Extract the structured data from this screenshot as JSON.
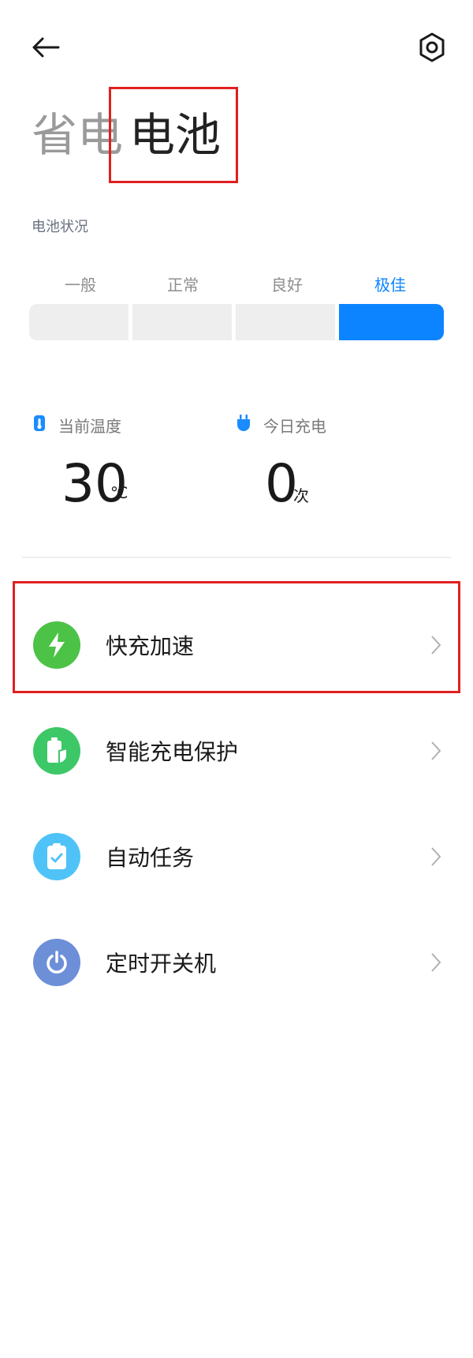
{
  "header": {
    "back_icon": "arrow-left-icon",
    "settings_icon": "hexagon-settings-icon"
  },
  "tabs": [
    {
      "label": "省电",
      "active": false
    },
    {
      "label": "电池",
      "active": true
    }
  ],
  "battery_status": {
    "title": "电池状况",
    "levels": [
      "一般",
      "正常",
      "良好",
      "极佳"
    ],
    "current_index": 3,
    "accent": "#0d84ff"
  },
  "stats": {
    "temperature": {
      "title": "当前温度",
      "value": "30",
      "unit": "℃",
      "icon": "thermometer-icon",
      "icon_color": "#1a8cff"
    },
    "charges_today": {
      "title": "今日充电",
      "value": "0",
      "unit": "次",
      "icon": "plug-icon",
      "icon_color": "#1a8cff"
    }
  },
  "menu": [
    {
      "label": "快充加速",
      "icon": "lightning-icon",
      "color": "#4cc246"
    },
    {
      "label": "智能充电保护",
      "icon": "battery-shield-icon",
      "color": "#3dc868"
    },
    {
      "label": "自动任务",
      "icon": "clipboard-check-icon",
      "color": "#4fc3f7"
    },
    {
      "label": "定时开关机",
      "icon": "power-icon",
      "color": "#6d8fd8"
    }
  ],
  "highlight_color": "#e02020"
}
